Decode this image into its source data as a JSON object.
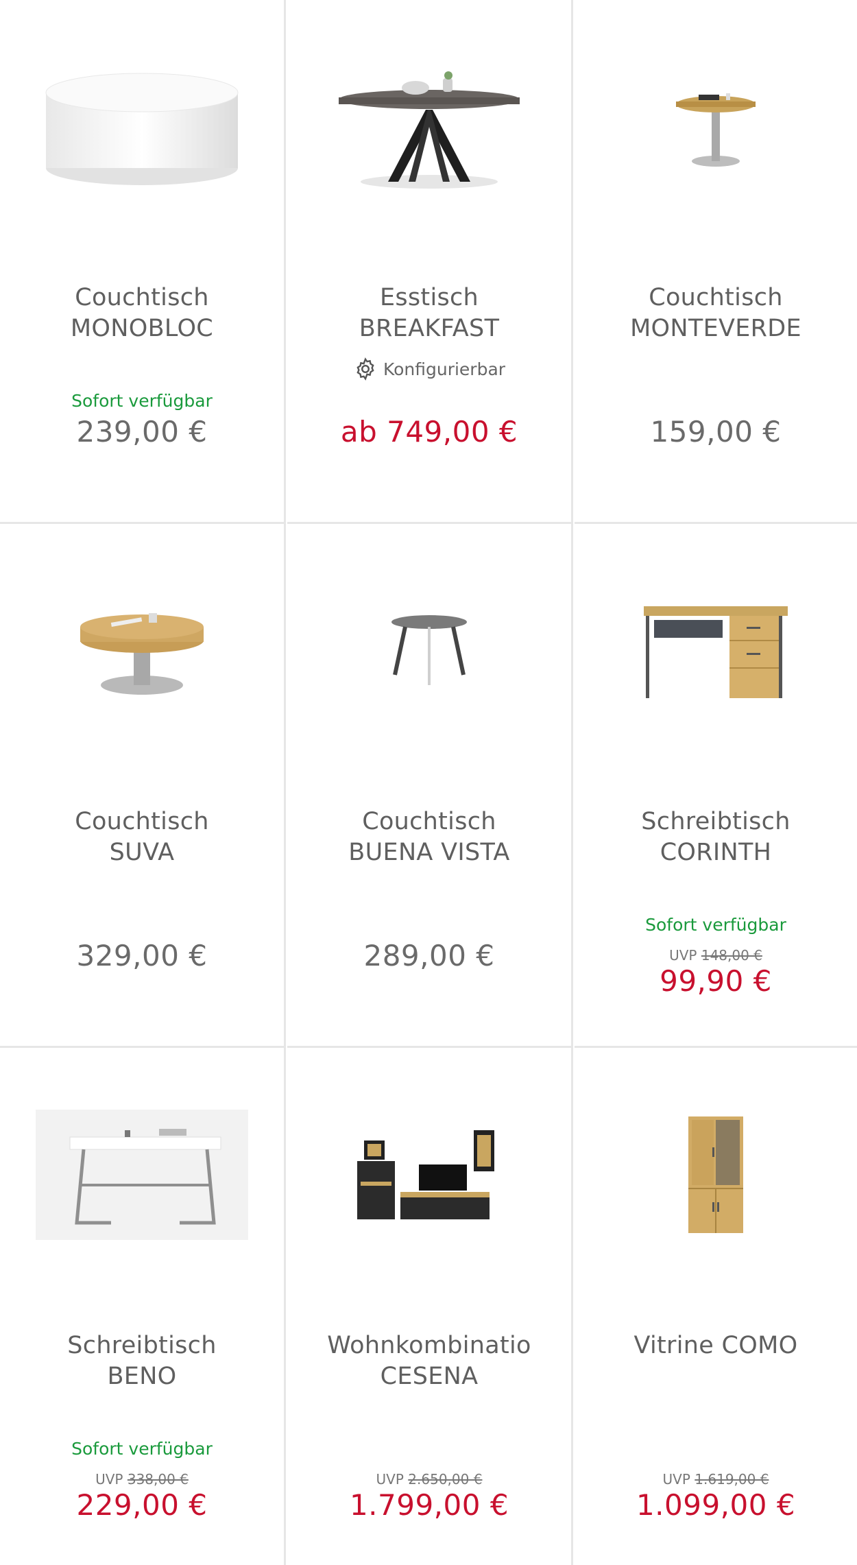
{
  "products": [
    {
      "name_line1": "Couchtisch",
      "name_line2": "MONOBLOC",
      "availability": "Sofort verfügbar",
      "uvp_label": "",
      "uvp_price": "",
      "price": "239,00 €",
      "price_red": false,
      "config": ""
    },
    {
      "name_line1": "Esstisch",
      "name_line2": "BREAKFAST",
      "availability": "",
      "uvp_label": "",
      "uvp_price": "",
      "price": "ab 749,00 €",
      "price_red": true,
      "config": "Konfigurierbar"
    },
    {
      "name_line1": "Couchtisch",
      "name_line2": "MONTEVERDE",
      "availability": "",
      "uvp_label": "",
      "uvp_price": "",
      "price": "159,00 €",
      "price_red": false,
      "config": ""
    },
    {
      "name_line1": "Couchtisch",
      "name_line2": "SUVA",
      "availability": "",
      "uvp_label": "",
      "uvp_price": "",
      "price": "329,00 €",
      "price_red": false,
      "config": ""
    },
    {
      "name_line1": "Couchtisch",
      "name_line2": "BUENA VISTA",
      "availability": "",
      "uvp_label": "",
      "uvp_price": "",
      "price": "289,00 €",
      "price_red": false,
      "config": ""
    },
    {
      "name_line1": "Schreibtisch",
      "name_line2": "CORINTH",
      "availability": "Sofort verfügbar",
      "uvp_label": "UVP",
      "uvp_price": "148,00 €",
      "price": "99,90 €",
      "price_red": true,
      "config": ""
    },
    {
      "name_line1": "Schreibtisch",
      "name_line2": "BENO",
      "availability": "Sofort verfügbar",
      "uvp_label": "UVP",
      "uvp_price": "338,00 €",
      "price": "229,00 €",
      "price_red": true,
      "config": ""
    },
    {
      "name_line1": "Wohnkombinatio",
      "name_line2": "CESENA",
      "availability": "",
      "uvp_label": "UVP",
      "uvp_price": "2.650,00 €",
      "price": "1.799,00 €",
      "price_red": true,
      "config": ""
    },
    {
      "name_line1": "Vitrine COMO",
      "name_line2": "",
      "availability": "",
      "uvp_label": "UVP",
      "uvp_price": "1.619,00 €",
      "price": "1.099,00 €",
      "price_red": true,
      "config": ""
    }
  ],
  "colors": {
    "sale_red": "#c8102e",
    "availability_green": "#1a9a3c",
    "text_gray": "#5f5f5f",
    "divider": "#e6e6e6"
  }
}
